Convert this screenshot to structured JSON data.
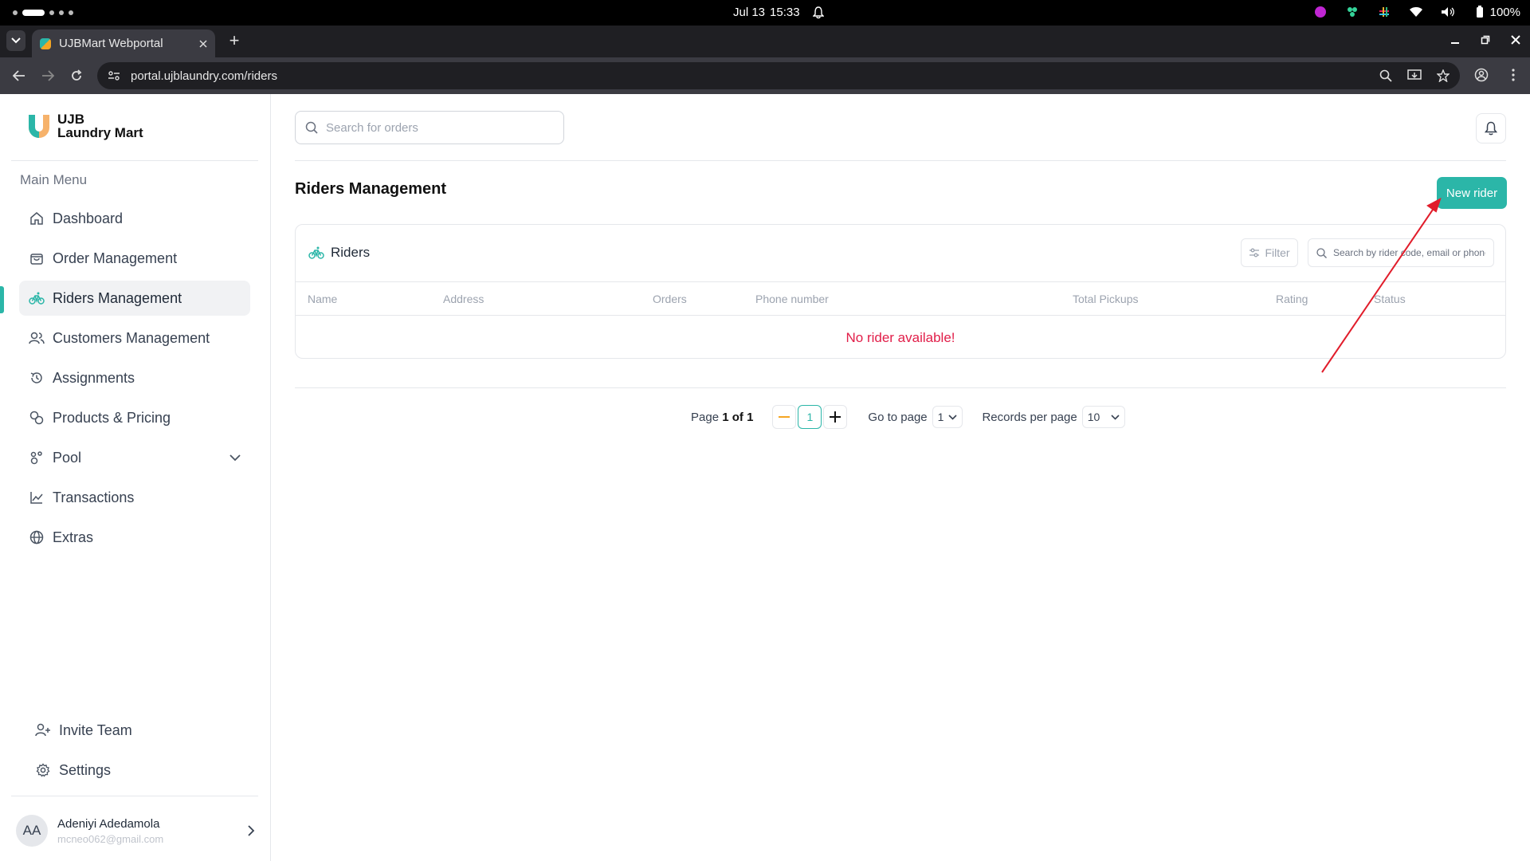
{
  "os": {
    "date": "Jul 13",
    "time": "15:33",
    "battery": "100%"
  },
  "browser": {
    "tab_title": "UJBMart Webportal",
    "url": "portal.ujblaundry.com/riders"
  },
  "brand": {
    "line1": "UJB",
    "line2": "Laundry Mart",
    "accent": "#2bb6a8"
  },
  "sidebar": {
    "section_label": "Main Menu",
    "items": [
      {
        "label": "Dashboard",
        "icon": "home-icon"
      },
      {
        "label": "Order Management",
        "icon": "shopping-bag-icon"
      },
      {
        "label": "Riders Management",
        "icon": "bicycle-icon",
        "active": true
      },
      {
        "label": "Customers Management",
        "icon": "users-icon"
      },
      {
        "label": "Assignments",
        "icon": "history-icon"
      },
      {
        "label": "Products & Pricing",
        "icon": "tags-icon"
      },
      {
        "label": "Pool",
        "icon": "pool-icon"
      },
      {
        "label": "Transactions",
        "icon": "chart-line-icon"
      },
      {
        "label": "Extras",
        "icon": "globe-icon"
      }
    ],
    "bottom": [
      {
        "label": "Invite Team",
        "icon": "user-plus-icon"
      },
      {
        "label": "Settings",
        "icon": "gear-icon"
      }
    ],
    "user": {
      "initials": "AA",
      "name": "Adeniyi Adedamola",
      "email": "mcneo062@gmail.com"
    }
  },
  "header": {
    "search_placeholder": "Search for orders"
  },
  "main": {
    "title": "Riders Management",
    "new_button": "New rider",
    "card_title": "Riders",
    "filter_label": "Filter",
    "rider_search_placeholder": "Search by rider code, email or phone",
    "columns": [
      "Name",
      "Address",
      "Orders",
      "Phone number",
      "Total Pickups",
      "Rating",
      "Status"
    ],
    "empty_message": "No rider available!",
    "empty_color": "#e11d48"
  },
  "pagination": {
    "page_prefix": "Page",
    "current": "1",
    "of_text": "of",
    "total": "1",
    "current_page_button": "1",
    "goto_label": "Go to page",
    "goto_value": "1",
    "records_label": "Records per page",
    "records_value": "10"
  },
  "annotation": {
    "arrow_color": "#e11d2b"
  }
}
